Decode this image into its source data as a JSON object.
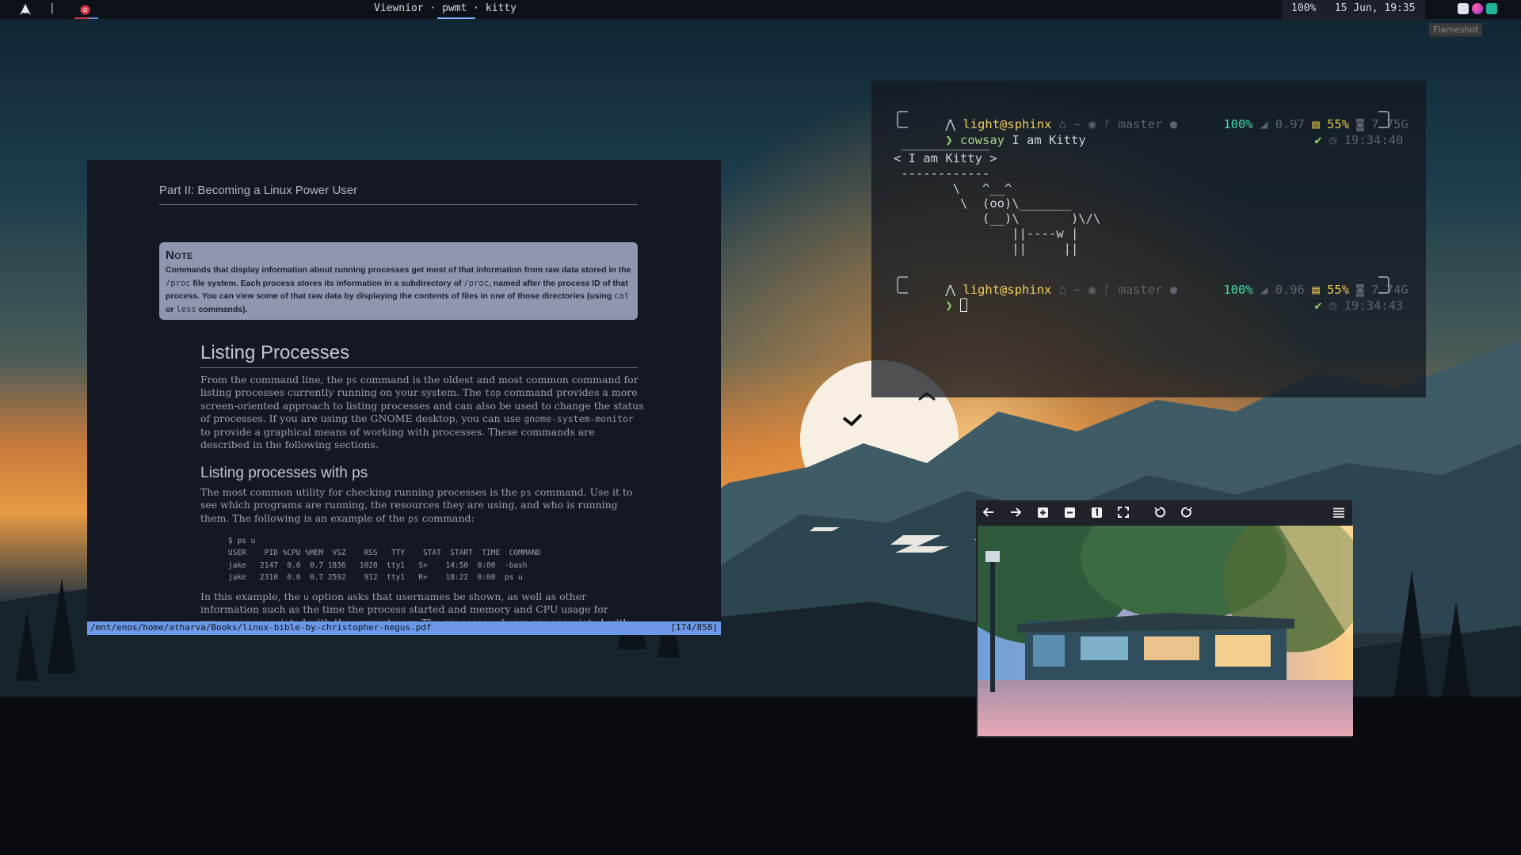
{
  "topbar": {
    "separator": "|",
    "window_title": "Viewnior · pwmt · kitty",
    "status": "100%   15 Jun, 19:35",
    "flameshot_label": "Flameshot"
  },
  "pdf": {
    "part_header": "Part II: Becoming a Linux Power User",
    "note": {
      "title": "Note",
      "body_a": "Commands that display information about running processes get most of that information from raw data stored in the ",
      "code_proc1": "/proc",
      "body_b": " file system. Each process stores its information in a subdirectory of ",
      "code_proc2": "/proc",
      "body_c": ", named after the process ID of that process. You can view some of that raw data by displaying the contents of files in one of those directories (using ",
      "code_cat": "cat",
      "body_d": " or ",
      "code_less": "less",
      "body_e": " commands)."
    },
    "heading1": "Listing Processes",
    "para1": {
      "a": "From the command line, the ",
      "code1": "ps",
      "b": " command is the oldest and most common command for listing processes currently running on your system. The ",
      "code2": "top",
      "c": " command provides a more screen-oriented approach to listing processes and can also be used to change the status of processes. If you are using the GNOME desktop, you can use ",
      "code3": "gnome-system-monitor",
      "d": " to provide a graphical means of working with processes. These commands are described in the following sections."
    },
    "heading2": "Listing processes with ps",
    "para2": {
      "a": "The most common utility for checking running processes is the ",
      "code1": "ps",
      "b": " command. Use it to see which programs are running, the resources they are using, and who is running them. The following is an example of the ",
      "code2": "ps",
      "c": " command:"
    },
    "ps_block": "$ ps u\nUSER    PID %CPU %MEM  VSZ    RSS   TTY    STAT  START  TIME  COMMAND\njake   2147  0.0  0.7 1836   1020  tty1   S+    14:50  0:00  -bash\njake   2310  0.0  0.7 2592    912  tty1   R+    18:22  0:00  ps u",
    "para3": {
      "a": "In this example, the ",
      "code1": "u",
      "b": " option asks that usernames be shown, as well as other information such as the time the process started and memory and CPU usage for processes associated with the current user. The processes shown are associated with the cur..."
    },
    "statusline": {
      "path": "/mnt/enos/home/atharva/Books/linux-bible-by-christopher-negus.pdf",
      "page": "[174/858]"
    }
  },
  "kitty": {
    "prompt1": {
      "user": "light@sphinx",
      "path": "~",
      "branch": "master",
      "right": {
        "pct": "100%",
        "load": "0.97",
        "mem_pct": "55%",
        "mem": "7.75G",
        "time": "19:34:40"
      },
      "cmd": "cowsay",
      "args": " I am Kitty"
    },
    "cowsay": " ____________\n< I am Kitty >\n ------------\n        \\   ^__^\n         \\  (oo)\\_______\n            (__)\\       )\\/\\\n                ||----w |\n                ||     ||",
    "prompt2": {
      "user": "light@sphinx",
      "path": "~",
      "branch": "master",
      "right": {
        "pct": "100%",
        "load": "0.96",
        "mem_pct": "55%",
        "mem": "7.74G",
        "time": "19:34:43"
      }
    }
  },
  "viewnior": {
    "toolbar_icons": [
      "arrow-left-icon",
      "arrow-right-icon",
      "zoom-in-icon",
      "zoom-out-icon",
      "actual-size-icon",
      "fullscreen-icon",
      "rotate-left-icon",
      "rotate-right-icon",
      "menu-icon"
    ]
  },
  "colors": {
    "pdf_background": "#141823",
    "pdf_statusline": "#6d98e8",
    "note_box": "#8f96b0",
    "terminal_user": "#f2cf60",
    "terminal_percent": "#43d9a8"
  }
}
